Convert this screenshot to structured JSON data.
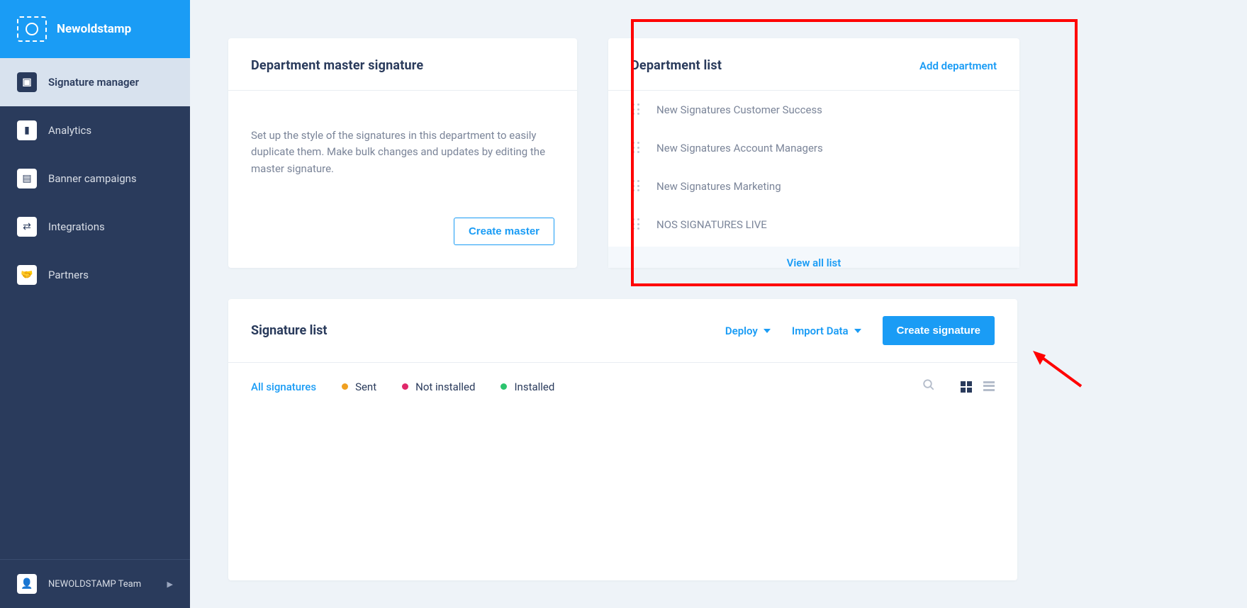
{
  "app": {
    "name": "Newoldstamp"
  },
  "sidebar": {
    "items": [
      {
        "label": "Signature manager"
      },
      {
        "label": "Analytics"
      },
      {
        "label": "Banner campaigns"
      },
      {
        "label": "Integrations"
      },
      {
        "label": "Partners"
      }
    ],
    "footer_label": "NEWOLDSTAMP Team"
  },
  "master_card": {
    "title": "Department master signature",
    "desc": "Set up the style of the signatures in this department to easily duplicate them. Make bulk changes and updates by editing the master signature.",
    "button": "Create master"
  },
  "dept_card": {
    "title": "Department list",
    "add_label": "Add department",
    "items": [
      {
        "name": "New Signatures Customer Success"
      },
      {
        "name": "New Signatures Account Managers"
      },
      {
        "name": "New Signatures Marketing"
      },
      {
        "name": "NOS SIGNATURES LIVE"
      }
    ],
    "view_all": "View all list"
  },
  "siglist": {
    "title": "Signature list",
    "deploy": "Deploy",
    "import": "Import Data",
    "create": "Create signature",
    "filters": {
      "all": "All signatures",
      "sent": "Sent",
      "not_installed": "Not installed",
      "installed": "Installed"
    },
    "colors": {
      "sent": "#f0a020",
      "not_installed": "#e0286a",
      "installed": "#2cc46e"
    }
  }
}
